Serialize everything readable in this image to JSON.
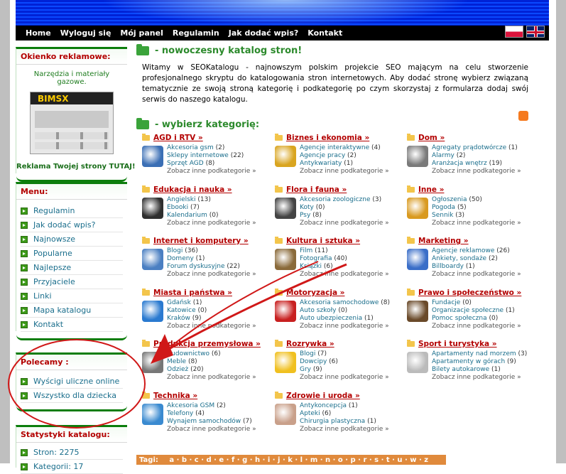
{
  "nav": {
    "items": [
      "Home",
      "Wyloguj się",
      "Mój panel",
      "Regulamin",
      "Jak dodać wpis?",
      "Kontakt"
    ]
  },
  "sidebar": {
    "ad": {
      "title": "Okienko reklamowe:",
      "text": "Narzędzia i materiały gazowe.",
      "logo": "BIMSX",
      "link": "Reklama Twojej strony TUTAJ!"
    },
    "menu": {
      "title": "Menu:",
      "items": [
        "Regulamin",
        "Jak dodać wpis?",
        "Najnowsze",
        "Popularne",
        "Najlepsze",
        "Przyjaciele",
        "Linki",
        "Mapa katalogu",
        "Kontakt"
      ]
    },
    "polecamy": {
      "title": "Polecamy :",
      "items": [
        "Wyścigi uliczne online",
        "Wszystko dla dziecka"
      ]
    },
    "stats": {
      "title": "Statystyki katalogu:",
      "items": [
        "Stron: 2275",
        "Kategorii: 17"
      ]
    }
  },
  "main": {
    "heading1": "- nowoczesny katalog stron!",
    "intro": "Witamy w SEOKatalogu - najnowszym polskim projekcie SEO mającym na celu stworzenie profesjonalnego skryptu do katalogowania stron internetowych. Aby dodać stronę wybierz związaną tematycznie ze swoją stroną kategorię i podkategorię po czym skorzystaj z formularza dodaj swój serwis do naszego katalogu.",
    "heading2": "- wybierz kategorię:",
    "more_label": "Zobacz inne podkategorie »",
    "tags_label": "Tagi:",
    "tags_letters": "a · b · c · d · e · f · g · h · i · j · k · l · m · n · o · p · r · s · t · u · w · z",
    "categories": [
      {
        "name": "AGD i RTV »",
        "subs": [
          [
            "Akcesoria gsm",
            "(2)"
          ],
          [
            "Sklepy internetowe",
            "(22)"
          ],
          [
            "Sprzęt AGD",
            "(8)"
          ]
        ]
      },
      {
        "name": "Biznes i ekonomia »",
        "subs": [
          [
            "Agencje interaktywne",
            "(4)"
          ],
          [
            "Agencje pracy",
            "(2)"
          ],
          [
            "Antykwariaty",
            "(1)"
          ]
        ]
      },
      {
        "name": "Dom »",
        "subs": [
          [
            "Agregaty prądotwórcze",
            "(1)"
          ],
          [
            "Alarmy",
            "(2)"
          ],
          [
            "Aranżacja wnętrz",
            "(19)"
          ]
        ]
      },
      {
        "name": "Edukacja i nauka »",
        "subs": [
          [
            "Angielski",
            "(13)"
          ],
          [
            "Ebooki",
            "(7)"
          ],
          [
            "Kalendarium",
            "(0)"
          ]
        ]
      },
      {
        "name": "Flora i fauna »",
        "subs": [
          [
            "Akcesoria zoologiczne",
            "(3)"
          ],
          [
            "Koty",
            "(0)"
          ],
          [
            "Psy",
            "(8)"
          ]
        ]
      },
      {
        "name": "Inne »",
        "subs": [
          [
            "Ogłoszenia",
            "(50)"
          ],
          [
            "Pogoda",
            "(5)"
          ],
          [
            "Sennik",
            "(3)"
          ]
        ]
      },
      {
        "name": "Internet i komputery »",
        "subs": [
          [
            "Blogi",
            "(36)"
          ],
          [
            "Domeny",
            "(1)"
          ],
          [
            "Forum dyskusyjne",
            "(22)"
          ]
        ]
      },
      {
        "name": "Kultura i sztuka »",
        "subs": [
          [
            "Film",
            "(11)"
          ],
          [
            "Fotografia",
            "(40)"
          ],
          [
            "Książki",
            "(6)"
          ]
        ]
      },
      {
        "name": "Marketing »",
        "subs": [
          [
            "Agencje reklamowe",
            "(26)"
          ],
          [
            "Ankiety, sondaże",
            "(2)"
          ],
          [
            "Billboardy",
            "(1)"
          ]
        ]
      },
      {
        "name": "Miasta i państwa »",
        "subs": [
          [
            "Gdańsk",
            "(1)"
          ],
          [
            "Katowice",
            "(0)"
          ],
          [
            "Kraków",
            "(9)"
          ]
        ]
      },
      {
        "name": "Motoryzacja »",
        "subs": [
          [
            "Akcesoria samochodowe",
            "(8)"
          ],
          [
            "Auto szkoły",
            "(0)"
          ],
          [
            "Auto ubezpieczenia",
            "(1)"
          ]
        ]
      },
      {
        "name": "Prawo i społeczeństwo »",
        "subs": [
          [
            "Fundacje",
            "(0)"
          ],
          [
            "Organizacje społeczne",
            "(1)"
          ],
          [
            "Pomoc społeczna",
            "(0)"
          ]
        ]
      },
      {
        "name": "Produkcja przemysłowa »",
        "subs": [
          [
            "Budownictwo",
            "(6)"
          ],
          [
            "Meble",
            "(8)"
          ],
          [
            "Odzież",
            "(20)"
          ]
        ]
      },
      {
        "name": "Rozrywka »",
        "subs": [
          [
            "Blogi",
            "(7)"
          ],
          [
            "Dowcipy",
            "(6)"
          ],
          [
            "Gry",
            "(9)"
          ]
        ]
      },
      {
        "name": "Sport i turystyka »",
        "subs": [
          [
            "Apartamenty nad morzem",
            "(3)"
          ],
          [
            "Apartamenty w górach",
            "(9)"
          ],
          [
            "Bilety autokarowe",
            "(1)"
          ]
        ]
      },
      {
        "name": "Technika »",
        "subs": [
          [
            "Akcesoria GSM",
            "(2)"
          ],
          [
            "Telefony",
            "(4)"
          ],
          [
            "Wynajem samochodów",
            "(7)"
          ]
        ]
      },
      {
        "name": "Zdrowie i uroda »",
        "subs": [
          [
            "Antykoncepcja",
            "(1)"
          ],
          [
            "Apteki",
            "(6)"
          ],
          [
            "Chirurgia plastyczna",
            "(1)"
          ]
        ]
      }
    ]
  },
  "colors": {
    "accent_green": "#2c8a2c",
    "category_red": "#b30000",
    "link_blue": "#1a6e8c",
    "header_blue": "#0022d6",
    "annotation_red": "#d01818"
  }
}
